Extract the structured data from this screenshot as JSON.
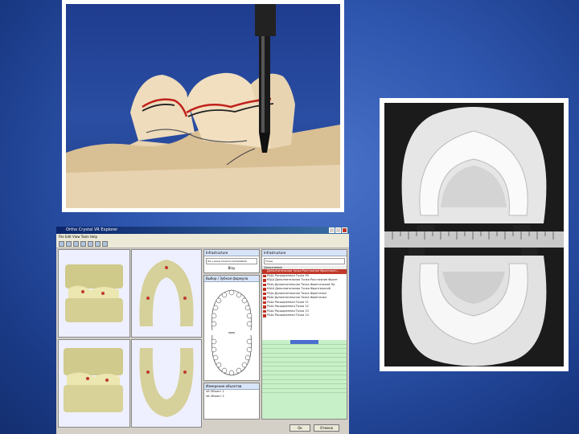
{
  "software": {
    "window_title": "Ortho Crystal VR Explorer",
    "menu": "File  Edit  View  Tools  Help",
    "panels": {
      "top_center_title": "Infrastructure",
      "top_center_dropdown": "US u Level Arrow Incrementation",
      "tooth_label": "Blay",
      "diagram_title": "Выбор / Зубная формула",
      "bottom_left_title": "Измерение объектов",
      "bottom_left_rows": [
        "VA Объект 1",
        "VA Объект 2"
      ],
      "right_title": "Infrastructure",
      "right_dropdown": "Точки",
      "right_sub": "Дополнения"
    },
    "right_list": [
      "Дополнительная точка Расстояние Фронтальн...",
      "Р&Ш Расширенная Точка 99",
      "К&Ш Дополнительная Точка Расстояние Фронт",
      "Р&Ш Дополнительная Точка Фронтальной Пр",
      "К&Ш Дополнительная Точка Фронтальной",
      "Р&Ш Дополнительная Точка Фронтальн",
      "Р&Ш Дополнительная Точка Фронтальн",
      "Р&Ш Расширенная Точка 11",
      "Р&Ш Расширенная Точка 12",
      "Р&Ш Расширенная Точка 13",
      "Р&Ш Расширенная Точка 14"
    ],
    "buttons": {
      "ok": "Ок",
      "cancel": "Отмена"
    }
  },
  "casts_photo": {
    "ruler": "ruler"
  }
}
